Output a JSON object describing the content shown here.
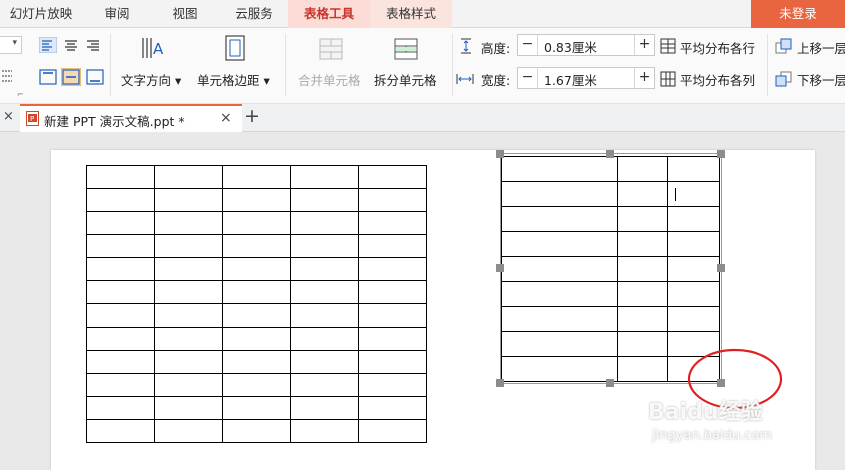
{
  "menu": {
    "tabs": [
      "幻灯片放映",
      "审阅",
      "视图",
      "云服务",
      "表格工具",
      "表格样式"
    ],
    "login": "未登录"
  },
  "ribbon": {
    "text_direction": "文字方向",
    "cell_margin": "单元格边距",
    "merge_cells": "合并单元格",
    "split_cells": "拆分单元格",
    "height_label": "高度:",
    "height_value": "0.83厘米",
    "width_label": "宽度:",
    "width_value": "1.67厘米",
    "distribute_rows": "平均分布各行",
    "distribute_cols": "平均分布各列",
    "move_up": "上移一层",
    "move_down": "下移一层"
  },
  "document_tab": {
    "label": "新建 PPT 演示文稿.ppt *"
  },
  "tables": {
    "left": {
      "rows": 12,
      "cols": 5
    },
    "right": {
      "rows": 9,
      "cols": 3
    }
  },
  "watermark": {
    "brand": "Baidu经验",
    "url": "jingyan.baidu.com"
  },
  "colors": {
    "accent": "#e8653f",
    "active_tab_bg": "#fbdcd6",
    "active_tab_text": "#c8372d",
    "annotation_circle": "#e02020"
  }
}
